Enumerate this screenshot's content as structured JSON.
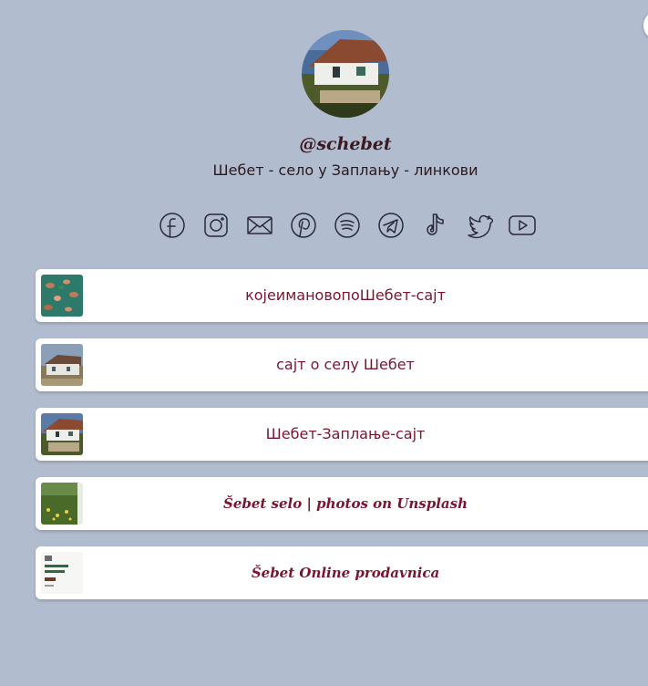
{
  "profile": {
    "handle": "@schebet",
    "bio": "Шебет - село у Заплању - линкови"
  },
  "socials": [
    {
      "name": "facebook-icon"
    },
    {
      "name": "instagram-icon"
    },
    {
      "name": "email-icon"
    },
    {
      "name": "pinterest-icon"
    },
    {
      "name": "spotify-icon"
    },
    {
      "name": "telegram-icon"
    },
    {
      "name": "tiktok-icon"
    },
    {
      "name": "twitter-icon"
    },
    {
      "name": "youtube-icon"
    }
  ],
  "links": [
    {
      "label": "којеимановопоШебет-сајт",
      "thumb": "leaves-thumbnail"
    },
    {
      "label": "сајт о селу Шебет",
      "thumb": "house-thumbnail"
    },
    {
      "label": "Шебет-Заплање-сајт",
      "thumb": "house-fence-thumbnail"
    },
    {
      "label": "Šebet selo | photos on Unsplash",
      "thumb": "meadow-thumbnail"
    },
    {
      "label": "Šebet Online prodavnica",
      "thumb": "shop-thumbnail"
    }
  ],
  "colors": {
    "background": "#b1bccf",
    "link_text": "#7a1530",
    "card": "#ffffff"
  }
}
